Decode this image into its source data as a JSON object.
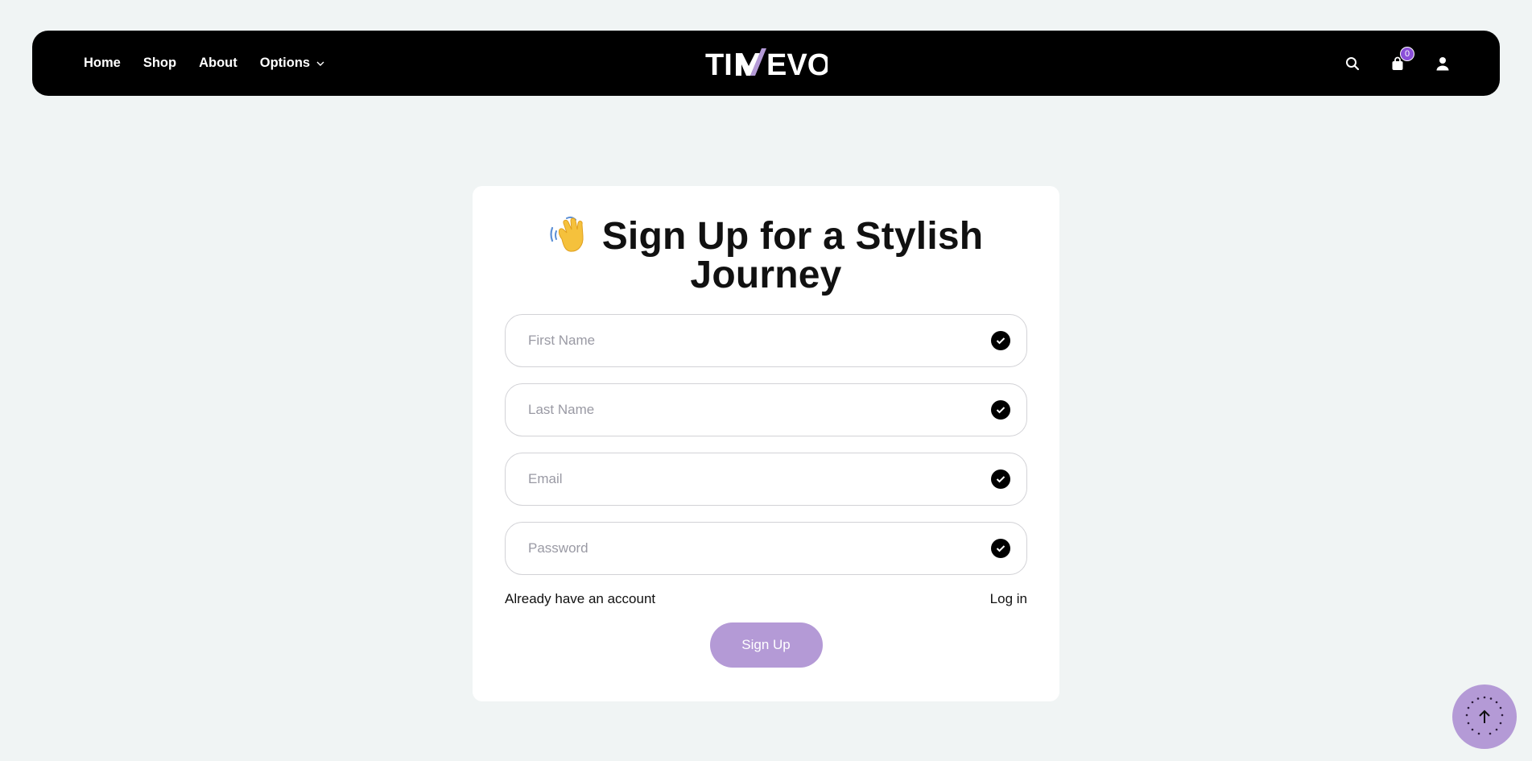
{
  "nav": {
    "links": [
      {
        "label": "Home"
      },
      {
        "label": "Shop"
      },
      {
        "label": "About"
      },
      {
        "label": "Options"
      }
    ],
    "logo_text": "TIMEVO",
    "cart_count": "0"
  },
  "form": {
    "title": "Sign Up for a Stylish Journey",
    "fields": [
      {
        "placeholder": "First Name",
        "value": ""
      },
      {
        "placeholder": "Last Name",
        "value": ""
      },
      {
        "placeholder": "Email",
        "value": ""
      },
      {
        "placeholder": "Password",
        "value": ""
      }
    ],
    "already_text": "Already have an account",
    "login_label": "Log in",
    "submit_label": "Sign Up"
  },
  "colors": {
    "accent": "#b49ad6",
    "badge": "#8a4fd8",
    "nav_bg": "#000000",
    "page_bg": "#f0f4f4"
  },
  "icons": {
    "search": "search-icon",
    "cart": "shopping-bag-icon",
    "user": "user-icon",
    "check": "check-circle-icon",
    "scroll_top": "arrow-up-icon"
  }
}
